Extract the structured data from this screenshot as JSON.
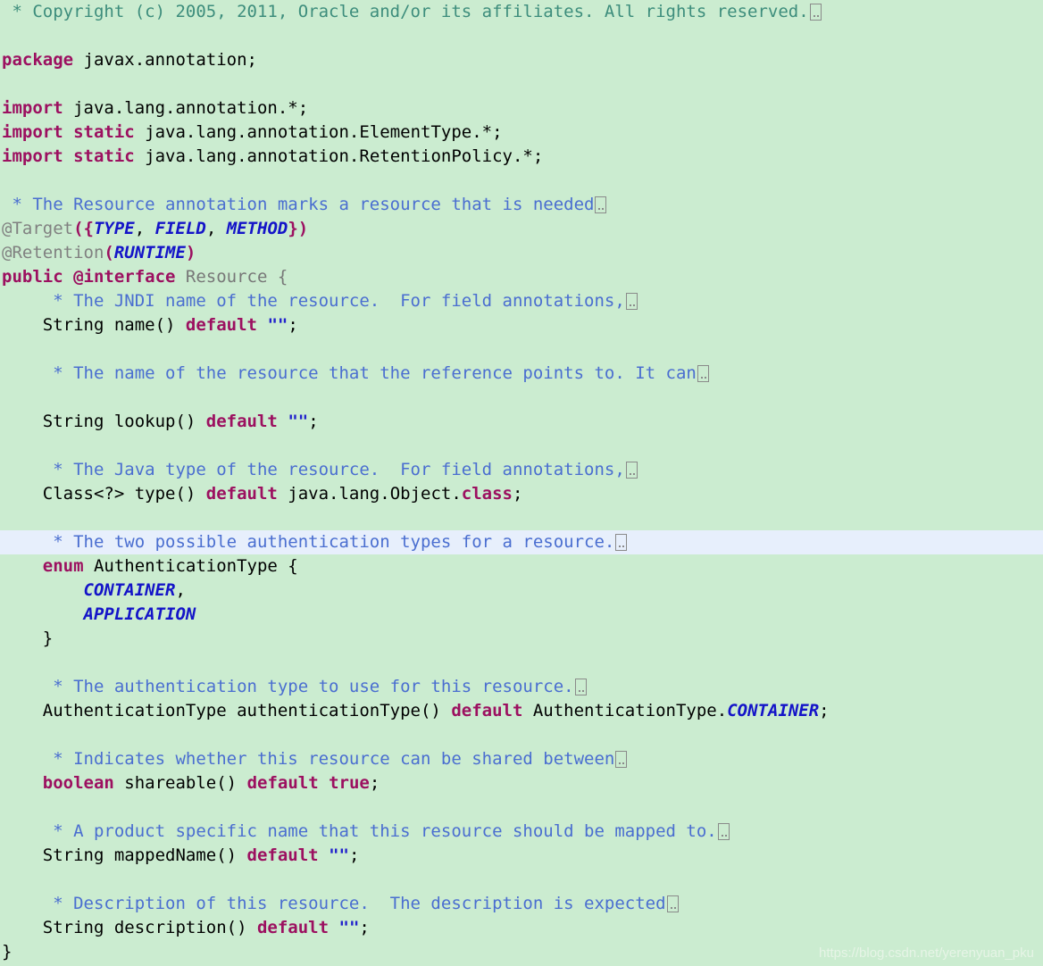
{
  "editor": {
    "language": "java",
    "background_color": "#cbecd0",
    "highlight_color": "#e7effc",
    "fold_marker": "…",
    "colors": {
      "keyword": "#9c1060",
      "comment_teal": "#3d8d7c",
      "comment_blue": "#4a6ed0",
      "annotation": "#808080",
      "type": "#777777",
      "constant": "#1414c8",
      "string": "#2222cc",
      "plain": "#000000"
    }
  },
  "watermark": {
    "text": "https://blog.csdn.net/yerenyuan_pku"
  },
  "lines": [
    {
      "n": 1,
      "highlighted": false,
      "tokens": [
        {
          "t": " * Copyright (c) 2005, 2011, Oracle and/or its affiliates. All rights reserved.",
          "c": "tok-cmt-teal"
        },
        {
          "t": "",
          "c": "fold"
        }
      ]
    },
    {
      "n": 2,
      "highlighted": false,
      "tokens": []
    },
    {
      "n": 3,
      "highlighted": false,
      "tokens": [
        {
          "t": "package",
          "c": "tok-kw"
        },
        {
          "t": " javax.annotation;",
          "c": "tok-plain"
        }
      ]
    },
    {
      "n": 4,
      "highlighted": false,
      "tokens": []
    },
    {
      "n": 5,
      "highlighted": false,
      "tokens": [
        {
          "t": "import",
          "c": "tok-kw"
        },
        {
          "t": " java.lang.annotation.*;",
          "c": "tok-plain"
        }
      ]
    },
    {
      "n": 6,
      "highlighted": false,
      "tokens": [
        {
          "t": "import static",
          "c": "tok-kw"
        },
        {
          "t": " java.lang.annotation.ElementType.*;",
          "c": "tok-plain"
        }
      ]
    },
    {
      "n": 7,
      "highlighted": false,
      "tokens": [
        {
          "t": "import static",
          "c": "tok-kw"
        },
        {
          "t": " java.lang.annotation.RetentionPolicy.*;",
          "c": "tok-plain"
        }
      ]
    },
    {
      "n": 8,
      "highlighted": false,
      "tokens": []
    },
    {
      "n": 9,
      "highlighted": false,
      "tokens": [
        {
          "t": " * The Resource annotation marks a resource that is needed",
          "c": "tok-cmt"
        },
        {
          "t": "",
          "c": "fold"
        }
      ]
    },
    {
      "n": 10,
      "highlighted": false,
      "tokens": [
        {
          "t": "@Target",
          "c": "tok-anno"
        },
        {
          "t": "({",
          "c": "tok-punct"
        },
        {
          "t": "TYPE",
          "c": "tok-const"
        },
        {
          "t": ", ",
          "c": "tok-plain"
        },
        {
          "t": "FIELD",
          "c": "tok-const"
        },
        {
          "t": ", ",
          "c": "tok-plain"
        },
        {
          "t": "METHOD",
          "c": "tok-const"
        },
        {
          "t": "})",
          "c": "tok-punct"
        }
      ]
    },
    {
      "n": 11,
      "highlighted": false,
      "tokens": [
        {
          "t": "@Retention",
          "c": "tok-anno"
        },
        {
          "t": "(",
          "c": "tok-punct"
        },
        {
          "t": "RUNTIME",
          "c": "tok-const"
        },
        {
          "t": ")",
          "c": "tok-punct"
        }
      ]
    },
    {
      "n": 12,
      "highlighted": false,
      "tokens": [
        {
          "t": "public @interface",
          "c": "tok-kw"
        },
        {
          "t": " Resource {",
          "c": "tok-type"
        }
      ]
    },
    {
      "n": 13,
      "highlighted": false,
      "tokens": [
        {
          "t": "     * The JNDI name of the resource.  For field annotations,",
          "c": "tok-cmt"
        },
        {
          "t": "",
          "c": "fold"
        }
      ]
    },
    {
      "n": 14,
      "highlighted": false,
      "tokens": [
        {
          "t": "    String name() ",
          "c": "tok-plain"
        },
        {
          "t": "default",
          "c": "tok-kw"
        },
        {
          "t": " ",
          "c": "tok-plain"
        },
        {
          "t": "\"\"",
          "c": "tok-str"
        },
        {
          "t": ";",
          "c": "tok-plain"
        }
      ]
    },
    {
      "n": 15,
      "highlighted": false,
      "tokens": []
    },
    {
      "n": 16,
      "highlighted": false,
      "tokens": [
        {
          "t": "     * The name of the resource that the reference points to. It can",
          "c": "tok-cmt"
        },
        {
          "t": "",
          "c": "fold"
        }
      ]
    },
    {
      "n": 17,
      "highlighted": false,
      "tokens": []
    },
    {
      "n": 18,
      "highlighted": false,
      "tokens": [
        {
          "t": "    String lookup() ",
          "c": "tok-plain"
        },
        {
          "t": "default",
          "c": "tok-kw"
        },
        {
          "t": " ",
          "c": "tok-plain"
        },
        {
          "t": "\"\"",
          "c": "tok-str"
        },
        {
          "t": ";",
          "c": "tok-plain"
        }
      ]
    },
    {
      "n": 19,
      "highlighted": false,
      "tokens": []
    },
    {
      "n": 20,
      "highlighted": false,
      "tokens": [
        {
          "t": "     * The Java type of the resource.  For field annotations,",
          "c": "tok-cmt"
        },
        {
          "t": "",
          "c": "fold"
        }
      ]
    },
    {
      "n": 21,
      "highlighted": false,
      "tokens": [
        {
          "t": "    Class<?> type() ",
          "c": "tok-plain"
        },
        {
          "t": "default",
          "c": "tok-kw"
        },
        {
          "t": " java.lang.Object.",
          "c": "tok-plain"
        },
        {
          "t": "class",
          "c": "tok-kw"
        },
        {
          "t": ";",
          "c": "tok-plain"
        }
      ]
    },
    {
      "n": 22,
      "highlighted": false,
      "tokens": []
    },
    {
      "n": 23,
      "highlighted": true,
      "tokens": [
        {
          "t": "     * The two possible authentication types for a resource.",
          "c": "tok-cmt"
        },
        {
          "t": "",
          "c": "fold"
        }
      ]
    },
    {
      "n": 24,
      "highlighted": false,
      "tokens": [
        {
          "t": "    ",
          "c": "tok-plain"
        },
        {
          "t": "enum",
          "c": "tok-kw"
        },
        {
          "t": " AuthenticationType {",
          "c": "tok-plain"
        }
      ]
    },
    {
      "n": 25,
      "highlighted": false,
      "tokens": [
        {
          "t": "        ",
          "c": "tok-plain"
        },
        {
          "t": "CONTAINER",
          "c": "tok-const"
        },
        {
          "t": ",",
          "c": "tok-plain"
        }
      ]
    },
    {
      "n": 26,
      "highlighted": false,
      "tokens": [
        {
          "t": "        ",
          "c": "tok-plain"
        },
        {
          "t": "APPLICATION",
          "c": "tok-const"
        }
      ]
    },
    {
      "n": 27,
      "highlighted": false,
      "tokens": [
        {
          "t": "    }",
          "c": "tok-plain"
        }
      ]
    },
    {
      "n": 28,
      "highlighted": false,
      "tokens": []
    },
    {
      "n": 29,
      "highlighted": false,
      "tokens": [
        {
          "t": "     * The authentication type to use for this resource.",
          "c": "tok-cmt"
        },
        {
          "t": "",
          "c": "fold"
        }
      ]
    },
    {
      "n": 30,
      "highlighted": false,
      "tokens": [
        {
          "t": "    AuthenticationType authenticationType() ",
          "c": "tok-plain"
        },
        {
          "t": "default",
          "c": "tok-kw"
        },
        {
          "t": " AuthenticationType.",
          "c": "tok-plain"
        },
        {
          "t": "CONTAINER",
          "c": "tok-const"
        },
        {
          "t": ";",
          "c": "tok-plain"
        }
      ]
    },
    {
      "n": 31,
      "highlighted": false,
      "tokens": []
    },
    {
      "n": 32,
      "highlighted": false,
      "tokens": [
        {
          "t": "     * Indicates whether this resource can be shared between",
          "c": "tok-cmt"
        },
        {
          "t": "",
          "c": "fold"
        }
      ]
    },
    {
      "n": 33,
      "highlighted": false,
      "tokens": [
        {
          "t": "    ",
          "c": "tok-plain"
        },
        {
          "t": "boolean",
          "c": "tok-kw"
        },
        {
          "t": " shareable() ",
          "c": "tok-plain"
        },
        {
          "t": "default",
          "c": "tok-kw"
        },
        {
          "t": " ",
          "c": "tok-plain"
        },
        {
          "t": "true",
          "c": "tok-kw"
        },
        {
          "t": ";",
          "c": "tok-plain"
        }
      ]
    },
    {
      "n": 34,
      "highlighted": false,
      "tokens": []
    },
    {
      "n": 35,
      "highlighted": false,
      "tokens": [
        {
          "t": "     * A product specific name that this resource should be mapped to.",
          "c": "tok-cmt"
        },
        {
          "t": "",
          "c": "fold"
        }
      ]
    },
    {
      "n": 36,
      "highlighted": false,
      "tokens": [
        {
          "t": "    String mappedName() ",
          "c": "tok-plain"
        },
        {
          "t": "default",
          "c": "tok-kw"
        },
        {
          "t": " ",
          "c": "tok-plain"
        },
        {
          "t": "\"\"",
          "c": "tok-str"
        },
        {
          "t": ";",
          "c": "tok-plain"
        }
      ]
    },
    {
      "n": 37,
      "highlighted": false,
      "tokens": []
    },
    {
      "n": 38,
      "highlighted": false,
      "tokens": [
        {
          "t": "     * Description of this resource.  The description is expected",
          "c": "tok-cmt"
        },
        {
          "t": "",
          "c": "fold"
        }
      ]
    },
    {
      "n": 39,
      "highlighted": false,
      "tokens": [
        {
          "t": "    String description() ",
          "c": "tok-plain"
        },
        {
          "t": "default",
          "c": "tok-kw"
        },
        {
          "t": " ",
          "c": "tok-plain"
        },
        {
          "t": "\"\"",
          "c": "tok-str"
        },
        {
          "t": ";",
          "c": "tok-plain"
        }
      ]
    },
    {
      "n": 40,
      "highlighted": false,
      "tokens": [
        {
          "t": "}",
          "c": "tok-plain"
        }
      ]
    }
  ]
}
